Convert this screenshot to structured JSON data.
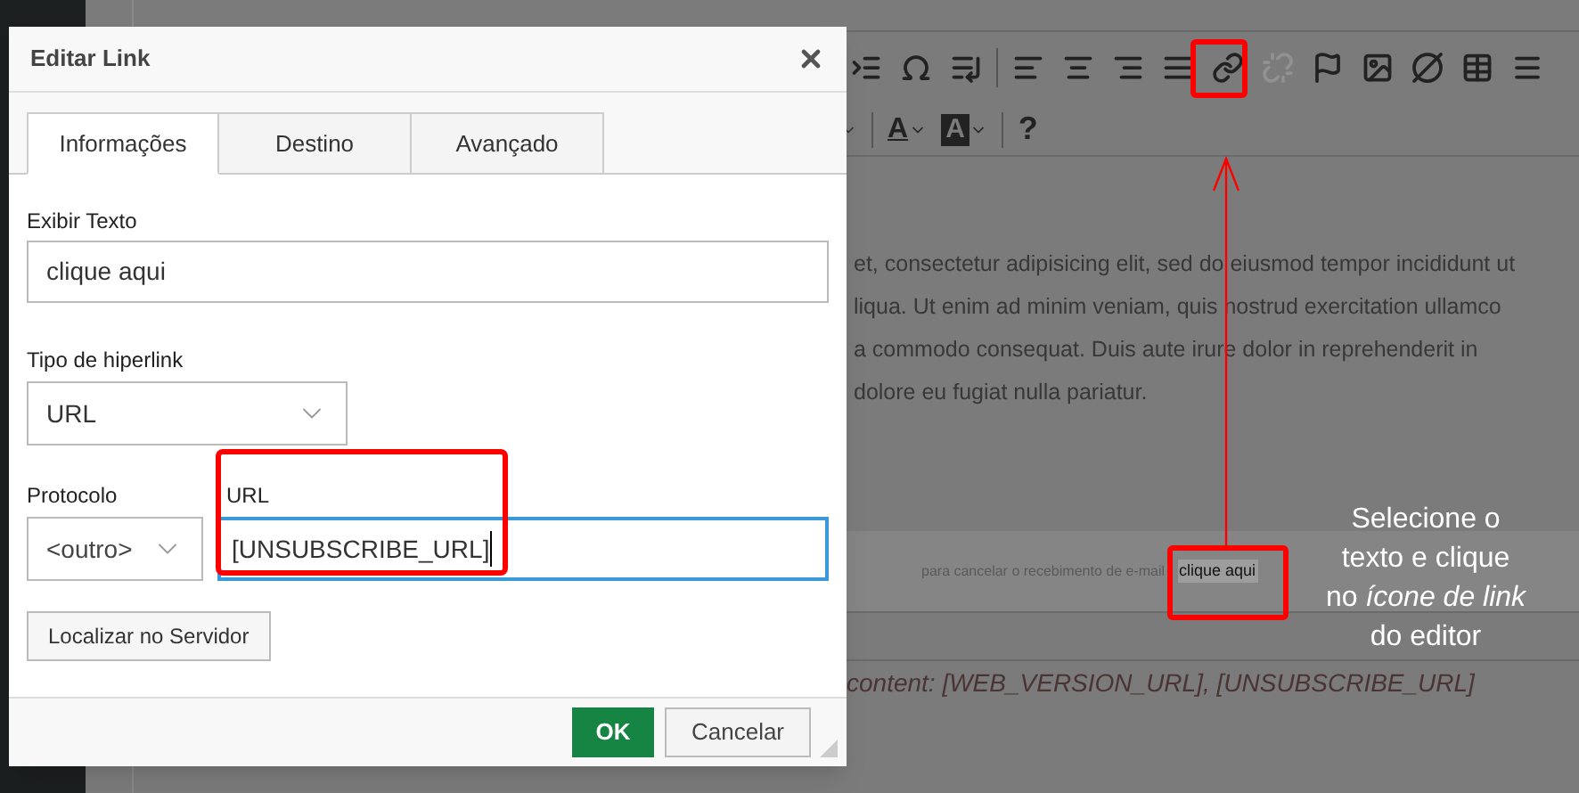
{
  "editor": {
    "toolbar_row_1": [
      {
        "kind": "indent",
        "disabled": false
      },
      {
        "kind": "omega",
        "disabled": false
      },
      {
        "kind": "blockquote",
        "disabled": false
      },
      {
        "kind": "separator"
      },
      {
        "kind": "align-left",
        "disabled": false
      },
      {
        "kind": "align-center",
        "disabled": false
      },
      {
        "kind": "align-right",
        "disabled": false
      },
      {
        "kind": "align-justify",
        "disabled": false
      },
      {
        "kind": "link",
        "disabled": false
      },
      {
        "kind": "unlink",
        "disabled": true
      },
      {
        "kind": "flag",
        "disabled": false
      },
      {
        "kind": "image",
        "disabled": false
      },
      {
        "kind": "flash",
        "disabled": false
      },
      {
        "kind": "table",
        "disabled": false
      },
      {
        "kind": "rule",
        "disabled": false
      }
    ],
    "toolbar_row_2": [
      {
        "kind": "caret"
      },
      {
        "kind": "separator"
      },
      {
        "kind": "text-color",
        "label": "A"
      },
      {
        "kind": "bg-color",
        "label": "A"
      },
      {
        "kind": "separator"
      },
      {
        "kind": "help",
        "label": "?"
      }
    ],
    "paragraph_lines": [
      "et, consectetur adipisicing elit, sed do eiusmod tempor incididunt ut",
      "liqua. Ut enim ad minim veniam, quis nostrud exercitation ullamco",
      "a commodo consequat. Duis aute irure dolor in reprehenderit in",
      "dolore eu fugiat nulla pariatur."
    ],
    "footer_text": "para cancelar o recebimento de e-mail",
    "footer_link": "clique aqui",
    "merge_tags": "content: [WEB_VERSION_URL], [UNSUBSCRIBE_URL]"
  },
  "annotation": {
    "lines": [
      "Selecione o",
      "texto e clique",
      "no *ícone de link*",
      "do editor"
    ]
  },
  "dialog": {
    "title": "Editar Link",
    "tabs": [
      {
        "label": "Informações",
        "selected": true
      },
      {
        "label": "Destino",
        "selected": false
      },
      {
        "label": "Avançado",
        "selected": false
      }
    ],
    "display_text": {
      "label": "Exibir Texto",
      "value": "clique aqui"
    },
    "link_type": {
      "label": "Tipo de hiperlink",
      "value": "URL"
    },
    "protocol": {
      "label": "Protocolo",
      "value": "<outro>"
    },
    "url": {
      "label": "URL",
      "value": "[UNSUBSCRIBE_URL]",
      "focused": true
    },
    "browse_button": "Localizar no Servidor",
    "ok_button": "OK",
    "cancel_button": "Cancelar"
  }
}
